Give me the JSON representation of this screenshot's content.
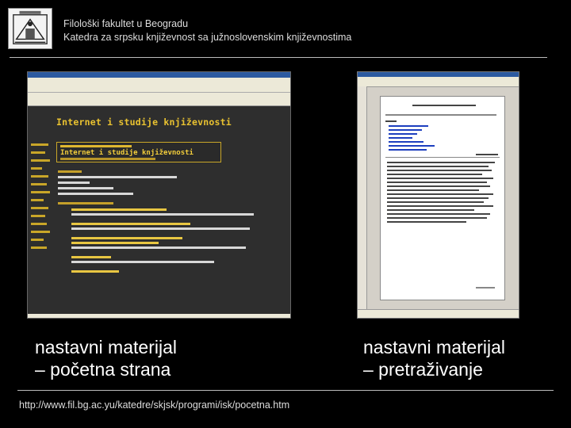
{
  "header": {
    "line1": "Filološki fakultet u Beogradu",
    "line2": "Katedra za srpsku književnost sa južnoslovenskim književnostima"
  },
  "left_screenshot": {
    "heading": "Internet i studije književnosti",
    "box_title": "Internet i studije književnosti"
  },
  "captions": {
    "left_line1": "nastavni materijal",
    "left_line2": "– početna strana",
    "right_line1": "nastavni materijal",
    "right_line2": "– pretraživanje"
  },
  "footer": {
    "url": "http://www.fil.bg.ac.yu/katedre/skjsk/programi/isk/pocetna.htm"
  },
  "colors": {
    "background": "#000000",
    "accent": "#e9c230"
  }
}
